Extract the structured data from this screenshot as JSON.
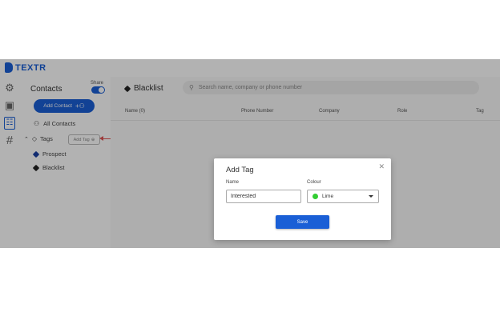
{
  "app": {
    "name": "TEXTR"
  },
  "rail": {
    "items": [
      "gear",
      "chat",
      "contacts",
      "hash"
    ]
  },
  "sidebar": {
    "title": "Contacts",
    "share_label": "Share",
    "add_contact_label": "Add Contact",
    "all_contacts_label": "All Contacts",
    "tags_label": "Tags",
    "add_tag_label": "Add Tag",
    "tags": [
      {
        "label": "Prospect",
        "color": "#1a3fa3"
      },
      {
        "label": "Blacklist",
        "color": "#222222"
      }
    ]
  },
  "main": {
    "list_title": "Blacklist",
    "search_placeholder": "Search name, company or phone number",
    "columns": [
      "Name (0)",
      "Phone Number",
      "Company",
      "Role",
      "Tag"
    ]
  },
  "modal": {
    "title": "Add Tag",
    "name_label": "Name",
    "name_value": "Interested",
    "colour_label": "Colour",
    "colour_value": "Lime",
    "colour_swatch": "#32cd32",
    "save_label": "Save"
  },
  "colors": {
    "accent": "#1a5fd6",
    "annotation": "#e05555"
  }
}
